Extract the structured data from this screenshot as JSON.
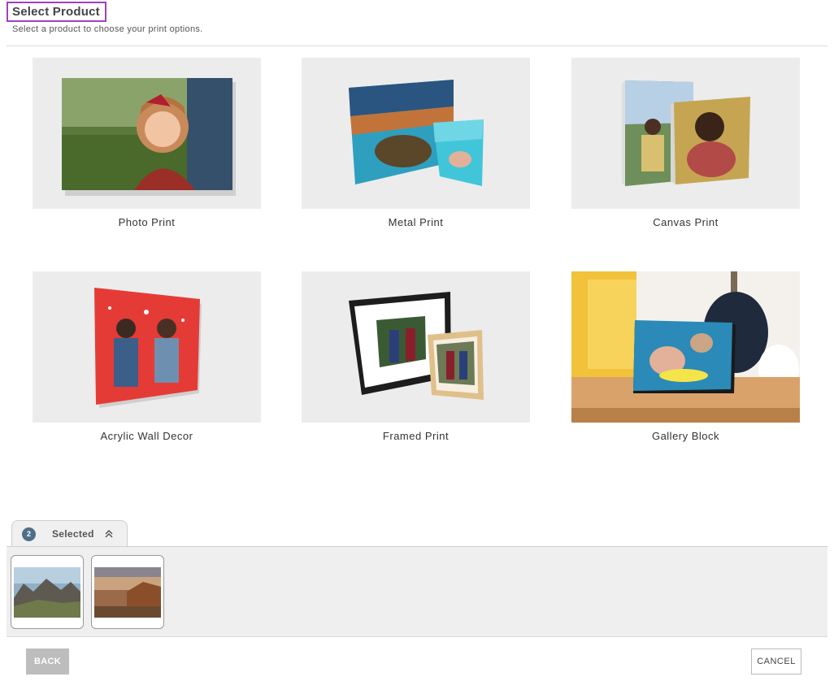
{
  "header": {
    "title": "Select Product",
    "subtitle": "Select a product to choose your print options."
  },
  "products": [
    {
      "label": "Photo Print"
    },
    {
      "label": "Metal Print"
    },
    {
      "label": "Canvas Print"
    },
    {
      "label": "Acrylic Wall Decor"
    },
    {
      "label": "Framed Print"
    },
    {
      "label": "Gallery Block"
    }
  ],
  "selected": {
    "count": "2",
    "label": "Selected",
    "icon": "chevron-double-up-icon"
  },
  "footer": {
    "back_label": "BACK",
    "cancel_label": "CANCEL"
  },
  "colors": {
    "title_outline": "#a040c0",
    "badge": "#4f6f88",
    "back_button": "#bdbdbd"
  }
}
